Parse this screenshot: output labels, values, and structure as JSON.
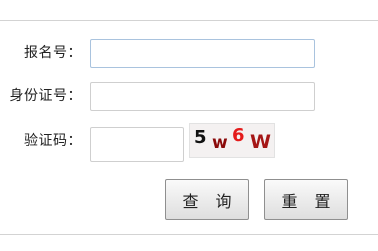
{
  "form": {
    "fields": [
      {
        "label": "报名号：",
        "value": "",
        "placeholder": ""
      },
      {
        "label": "身份证号：",
        "value": "",
        "placeholder": ""
      },
      {
        "label": "验证码：",
        "value": "",
        "placeholder": ""
      }
    ],
    "captcha": {
      "characters": [
        {
          "char": "5",
          "color": "#111111"
        },
        {
          "char": "w",
          "color": "#8b0a0a"
        },
        {
          "char": "6",
          "color": "#e41b1b"
        },
        {
          "char": "W",
          "color": "#a51616"
        }
      ]
    },
    "buttons": {
      "query_label": "查 询",
      "reset_label": "重 置"
    }
  }
}
